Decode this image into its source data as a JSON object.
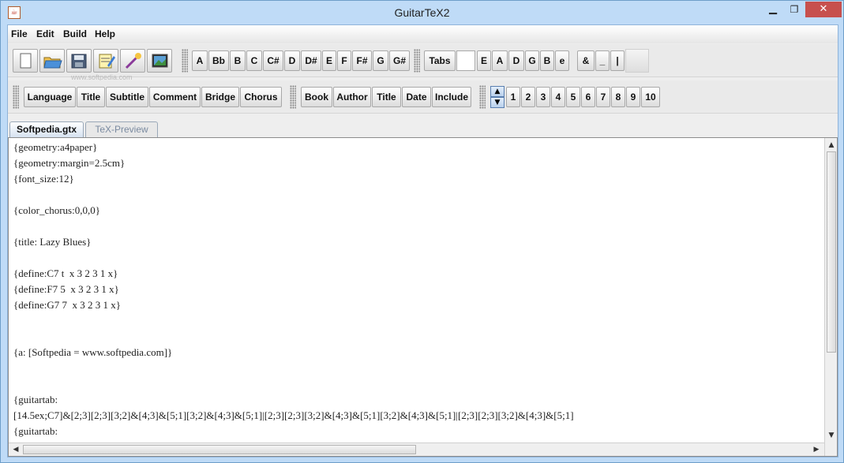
{
  "window": {
    "title": "GuitarTeX2"
  },
  "menu": [
    "File",
    "Edit",
    "Build",
    "Help"
  ],
  "toolbar1": {
    "icons": [
      "new-file-icon",
      "open-folder-icon",
      "save-disk-icon",
      "edit-notepad-icon",
      "magic-wand-icon",
      "image-icon"
    ],
    "chords": [
      "A",
      "Bb",
      "B",
      "C",
      "C#",
      "D",
      "D#",
      "E",
      "F",
      "F#",
      "G",
      "G#"
    ],
    "tabs_label": "Tabs",
    "strings": [
      "E",
      "A",
      "D",
      "G",
      "B",
      "e"
    ],
    "symbols": [
      "&",
      "_",
      "|"
    ]
  },
  "toolbar2": {
    "group1": [
      "Language",
      "Title",
      "Subtitle",
      "Comment",
      "Bridge",
      "Chorus"
    ],
    "group2": [
      "Book",
      "Author",
      "Title",
      "Date",
      "Include"
    ],
    "numbers": [
      "1",
      "2",
      "3",
      "4",
      "5",
      "6",
      "7",
      "8",
      "9",
      "10"
    ]
  },
  "tabs": [
    "Softpedia.gtx",
    "TeX-Preview"
  ],
  "editor": {
    "lines": [
      "{geometry:a4paper}",
      "{geometry:margin=2.5cm}",
      "{font_size:12}",
      "",
      "{color_chorus:0,0,0}",
      "",
      "{title: Lazy Blues}",
      "",
      "{define:C7 t  x 3 2 3 1 x}",
      "{define:F7 5  x 3 2 3 1 x}",
      "{define:G7 7  x 3 2 3 1 x}",
      "",
      "",
      "{a: [Softpedia = www.softpedia.com]}",
      "",
      "",
      "{guitartab:",
      "[14.5ex;C7]&[2;3][2;3][3;2]&[4;3]&[5;1][3;2]&[4;3]&[5;1]|[2;3][2;3][3;2]&[4;3]&[5;1][3;2]&[4;3]&[5;1]|[2;3][2;3][3;2]&[4;3]&[5;1]",
      "{guitartab:"
    ]
  },
  "watermark": "www.softpedia.com"
}
